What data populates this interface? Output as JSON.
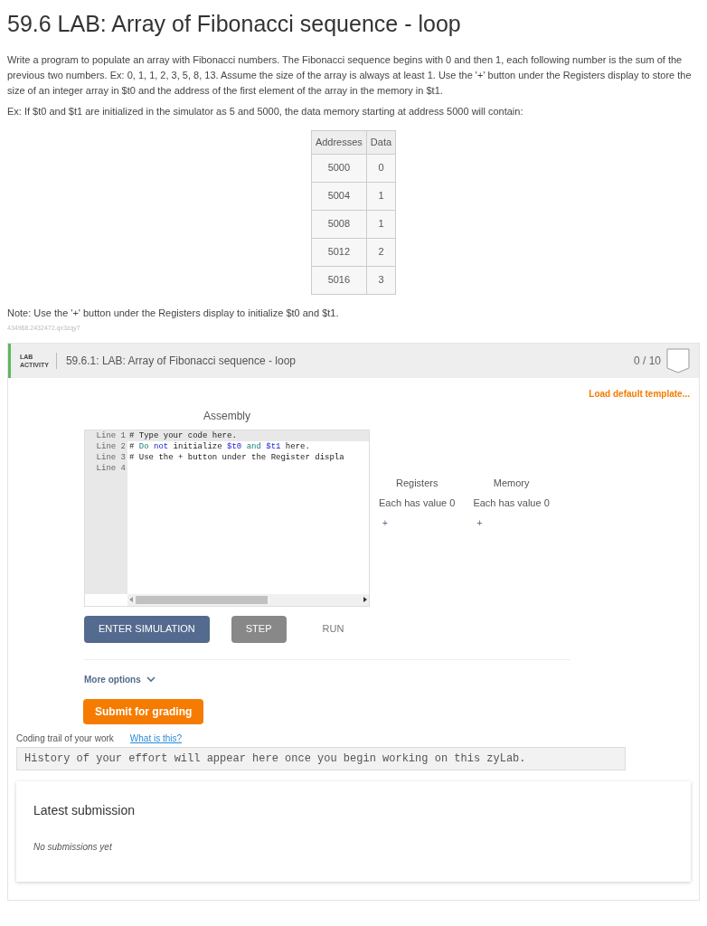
{
  "title": "59.6 LAB: Array of Fibonacci sequence - loop",
  "paragraphs": [
    "Write a program to populate an array with Fibonacci numbers. The Fibonacci sequence begins with 0 and then 1, each following number is the sum of the previous two numbers. Ex: 0, 1, 1, 2, 3, 5, 8, 13. Assume the size of the array is always at least 1. Use the '+' button under the Registers display to store the size of an integer array in $t0 and the address of the first element of the array in the memory in $t1.",
    "Ex: If $t0 and $t1 are initialized in the simulator as 5 and 5000, the data memory starting at address 5000 will contain:"
  ],
  "table": {
    "columns": [
      "Addresses",
      "Data"
    ],
    "rows": [
      [
        "5000",
        "0"
      ],
      [
        "5004",
        "1"
      ],
      [
        "5008",
        "1"
      ],
      [
        "5012",
        "2"
      ],
      [
        "5016",
        "3"
      ]
    ]
  },
  "note": "Note: Use the '+' button under the Registers display to initialize $t0 and $t1.",
  "code_id": "434968.2432472.qx3zqy7",
  "lab": {
    "badge_line_1": "LAB",
    "badge_line_2": "ACTIVITY",
    "heading": "59.6.1: LAB: Array of Fibonacci sequence - loop",
    "score": "0 / 10",
    "load_template": "Load default template...",
    "editor": {
      "title": "Assembly",
      "lines": [
        {
          "number": "Line 1",
          "active": true,
          "segments": [
            {
              "kind": "comment",
              "text": "# Type your code here."
            }
          ]
        },
        {
          "number": "Line 2",
          "active": false,
          "segments": [
            {
              "kind": "comment",
              "text": "# "
            },
            {
              "kind": "word",
              "text": "Do "
            },
            {
              "kind": "keyword",
              "text": "not"
            },
            {
              "kind": "comment",
              "text": " initialize "
            },
            {
              "kind": "register",
              "text": "$t0"
            },
            {
              "kind": "word",
              "text": " and "
            },
            {
              "kind": "register",
              "text": "$t1"
            },
            {
              "kind": "comment",
              "text": " here."
            }
          ]
        },
        {
          "number": "Line 3",
          "active": false,
          "segments": [
            {
              "kind": "comment",
              "text": "# Use the + button under the Register displa"
            }
          ]
        },
        {
          "number": "Line 4",
          "active": false
        }
      ]
    },
    "panels": [
      {
        "title": "Registers",
        "value": "Each has value 0",
        "add": "+"
      },
      {
        "title": "Memory",
        "value": "Each has value 0",
        "add": "+"
      }
    ],
    "buttons": [
      {
        "kind": "primary",
        "label": "ENTER SIMULATION"
      },
      {
        "kind": "secondary",
        "label": "STEP"
      },
      {
        "kind": "text",
        "label": "RUN"
      }
    ],
    "more_options": "More options",
    "submit": "Submit for grading",
    "trail_label": "Coding trail of your work",
    "trail_link": "What is this?",
    "trail_text": "History of your effort will appear here once you begin working on this zyLab.",
    "latest": {
      "title": "Latest submission",
      "empty": "No submissions yet"
    }
  }
}
